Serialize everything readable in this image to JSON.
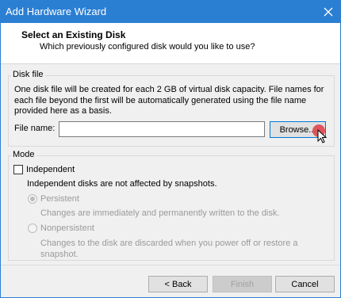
{
  "window": {
    "title": "Add Hardware Wizard"
  },
  "header": {
    "title": "Select an Existing Disk",
    "subtitle": "Which previously configured disk would you like to use?"
  },
  "disk_file": {
    "group_label": "Disk file",
    "description_line1": "One disk file will be created for each 2 GB of virtual disk capacity. File names for",
    "description_line2": "each file beyond the first will be automatically generated using the file name",
    "description_line3": "provided here as a basis.",
    "file_name_label": "File name:",
    "file_name_value": "",
    "browse_label": "Browse..."
  },
  "mode": {
    "group_label": "Mode",
    "independent_label": "Independent",
    "independent_checked": false,
    "independent_note": "Independent disks are not affected by snapshots.",
    "persistent_label": "Persistent",
    "persistent_selected": true,
    "persistent_desc": "Changes are immediately and permanently written to the disk.",
    "nonpersistent_label": "Nonpersistent",
    "nonpersistent_desc_line1": "Changes to the disk are discarded when you power off or restore a",
    "nonpersistent_desc_line2": "snapshot."
  },
  "footer": {
    "back_label": "< Back",
    "finish_label": "Finish",
    "cancel_label": "Cancel"
  },
  "colors": {
    "titlebar": "#2b7fd3",
    "click_indicator": "#e0464f"
  }
}
